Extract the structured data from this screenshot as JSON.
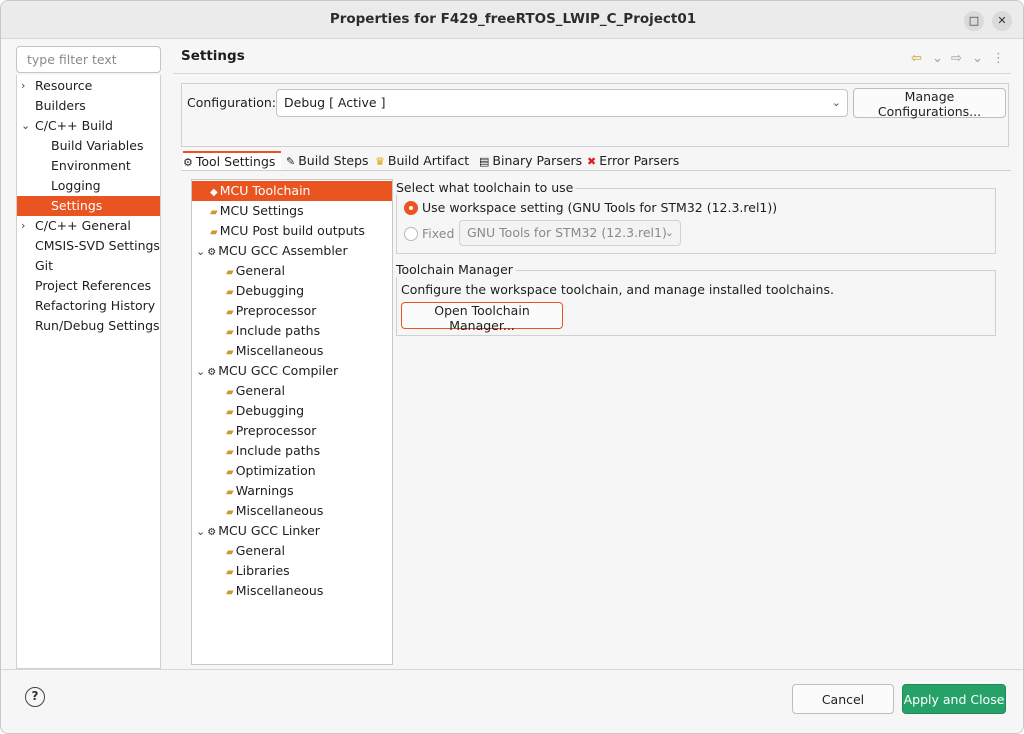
{
  "window": {
    "title": "Properties for F429_freeRTOS_LWIP_C_Project01",
    "maximize_glyph": "□",
    "close_glyph": "✕"
  },
  "sidebar": {
    "filter_placeholder": "type filter text",
    "items": [
      {
        "label": "Resource",
        "twisty": "›"
      },
      {
        "label": "Builders",
        "twisty": ""
      },
      {
        "label": "C/C++ Build",
        "twisty": "⌄"
      },
      {
        "label": "Build Variables",
        "twisty": ""
      },
      {
        "label": "Environment",
        "twisty": ""
      },
      {
        "label": "Logging",
        "twisty": ""
      },
      {
        "label": "Settings",
        "twisty": ""
      },
      {
        "label": "C/C++ General",
        "twisty": "›"
      },
      {
        "label": "CMSIS-SVD Settings",
        "twisty": ""
      },
      {
        "label": "Git",
        "twisty": ""
      },
      {
        "label": "Project References",
        "twisty": ""
      },
      {
        "label": "Refactoring History",
        "twisty": ""
      },
      {
        "label": "Run/Debug Settings",
        "twisty": ""
      }
    ]
  },
  "header": {
    "title": "Settings",
    "back_glyph": "⇦",
    "forward_glyph": "⇨",
    "dropdown_glyph": "⌄",
    "menu_glyph": "⋮"
  },
  "configuration": {
    "label": "Configuration:",
    "value": "Debug  [ Active ]",
    "chevron": "⌄",
    "manage_button": "Manage Configurations..."
  },
  "tabs": [
    {
      "label": "Tool Settings",
      "icon": "⚙"
    },
    {
      "label": "Build Steps",
      "icon": "✎"
    },
    {
      "label": "Build Artifact",
      "icon": "♛"
    },
    {
      "label": "Binary Parsers",
      "icon": "▤"
    },
    {
      "label": "Error Parsers",
      "icon": "✖"
    }
  ],
  "tree": {
    "items": [
      {
        "label": "MCU Toolchain",
        "icon": "◆",
        "twisty": ""
      },
      {
        "label": "MCU Settings",
        "icon": "▰",
        "twisty": ""
      },
      {
        "label": "MCU Post build outputs",
        "icon": "▰",
        "twisty": ""
      },
      {
        "label": "MCU GCC Assembler",
        "icon": "⚙",
        "twisty": "⌄"
      },
      {
        "label": "General",
        "icon": "▰",
        "twisty": ""
      },
      {
        "label": "Debugging",
        "icon": "▰",
        "twisty": ""
      },
      {
        "label": "Preprocessor",
        "icon": "▰",
        "twisty": ""
      },
      {
        "label": "Include paths",
        "icon": "▰",
        "twisty": ""
      },
      {
        "label": "Miscellaneous",
        "icon": "▰",
        "twisty": ""
      },
      {
        "label": "MCU GCC Compiler",
        "icon": "⚙",
        "twisty": "⌄"
      },
      {
        "label": "General",
        "icon": "▰",
        "twisty": ""
      },
      {
        "label": "Debugging",
        "icon": "▰",
        "twisty": ""
      },
      {
        "label": "Preprocessor",
        "icon": "▰",
        "twisty": ""
      },
      {
        "label": "Include paths",
        "icon": "▰",
        "twisty": ""
      },
      {
        "label": "Optimization",
        "icon": "▰",
        "twisty": ""
      },
      {
        "label": "Warnings",
        "icon": "▰",
        "twisty": ""
      },
      {
        "label": "Miscellaneous",
        "icon": "▰",
        "twisty": ""
      },
      {
        "label": "MCU GCC Linker",
        "icon": "⚙",
        "twisty": "⌄"
      },
      {
        "label": "General",
        "icon": "▰",
        "twisty": ""
      },
      {
        "label": "Libraries",
        "icon": "▰",
        "twisty": ""
      },
      {
        "label": "Miscellaneous",
        "icon": "▰",
        "twisty": ""
      }
    ]
  },
  "toolchain": {
    "group_title": "Select what toolchain to use",
    "workspace_option": "Use workspace setting (GNU Tools for STM32 (12.3.rel1))",
    "fixed_option": "Fixed",
    "fixed_value": "GNU Tools for STM32 (12.3.rel1)",
    "fixed_chevron": "⌄"
  },
  "manager": {
    "group_title": "Toolchain Manager",
    "description": "Configure the workspace toolchain, and manage installed toolchains.",
    "button": "Open Toolchain Manager..."
  },
  "footer": {
    "help_glyph": "?",
    "cancel": "Cancel",
    "apply": "Apply and Close"
  },
  "colors": {
    "accent": "#e95420",
    "primary_button": "#26a269"
  }
}
